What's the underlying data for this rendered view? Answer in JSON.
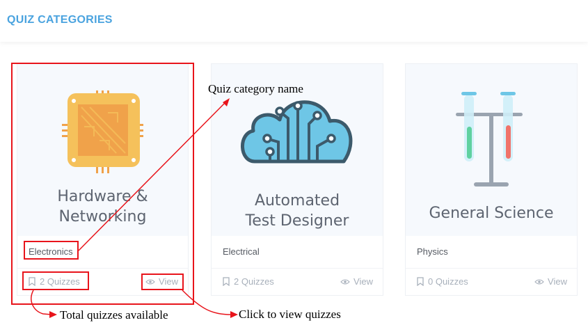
{
  "header": {
    "title": "QUIZ CATEGORIES"
  },
  "cards": [
    {
      "image_title_lines": [
        "Hardware &",
        "Networking"
      ],
      "category": "Electronics",
      "quizzes": "2 Quizzes",
      "view": "View",
      "icon": "chip-icon"
    },
    {
      "image_title_lines": [
        "Automated",
        "Test Designer"
      ],
      "category": "Electrical",
      "quizzes": "2 Quizzes",
      "view": "View",
      "icon": "cloud-circuit-icon"
    },
    {
      "image_title_lines": [
        "General Science"
      ],
      "category": "Physics",
      "quizzes": "0 Quizzes",
      "view": "View",
      "icon": "test-tubes-icon"
    }
  ],
  "annotations": {
    "category_name": "Quiz category name",
    "total_quizzes": "Total quizzes available",
    "click_view": "Click to view quizzes"
  },
  "colors": {
    "accent": "#4aa3df",
    "annotation": "#e8141b"
  }
}
